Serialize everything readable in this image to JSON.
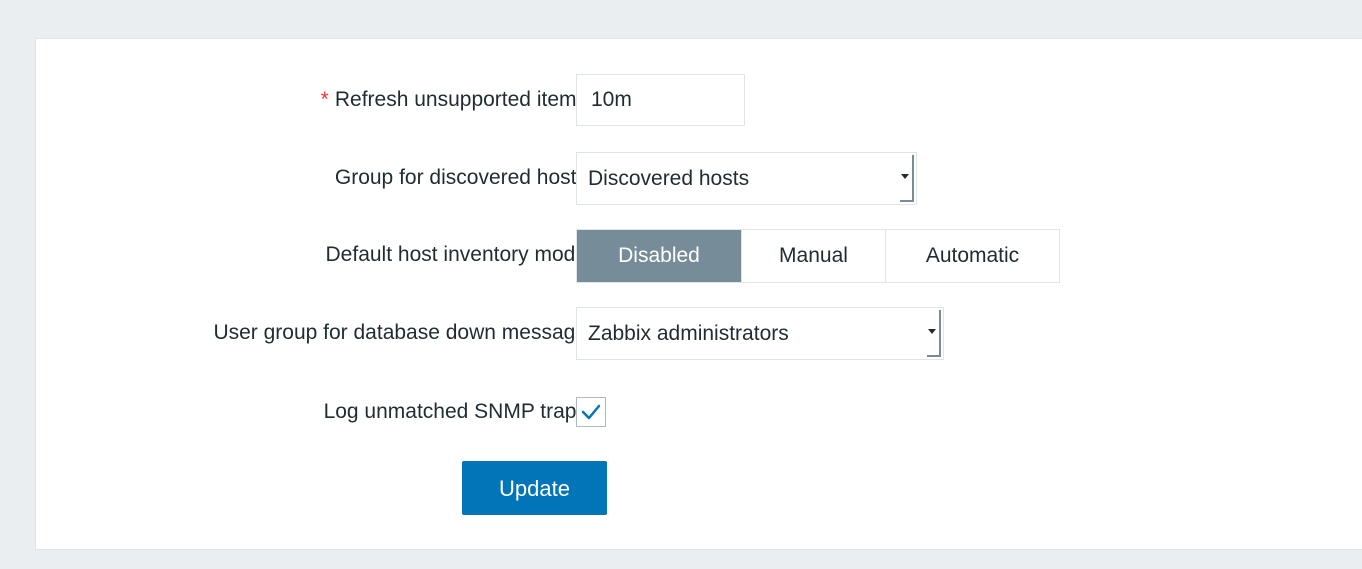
{
  "form": {
    "refresh_unsupported": {
      "required_marker": "*",
      "label": "Refresh unsupported items",
      "value": "10m"
    },
    "discovery_group": {
      "label": "Group for discovered hosts",
      "selected": "Discovered hosts"
    },
    "inventory_mode": {
      "label": "Default host inventory mode",
      "options": [
        "Disabled",
        "Manual",
        "Automatic"
      ],
      "selected": "Disabled"
    },
    "alert_usrgrp": {
      "label": "User group for database down message",
      "selected": "Zabbix administrators"
    },
    "snmptrap_logging": {
      "label": "Log unmatched SNMP traps",
      "checked": true
    },
    "submit_label": "Update"
  },
  "colors": {
    "page_bg": "#ebeef0",
    "panel_bg": "#ffffff",
    "required": "#e33734",
    "selected_segment": "#768d99",
    "primary_button": "#0275b8",
    "checkmark": "#0275b8"
  },
  "icons": {
    "checkbox": "checkmark-icon",
    "select": "dropdown-arrow-icon"
  }
}
